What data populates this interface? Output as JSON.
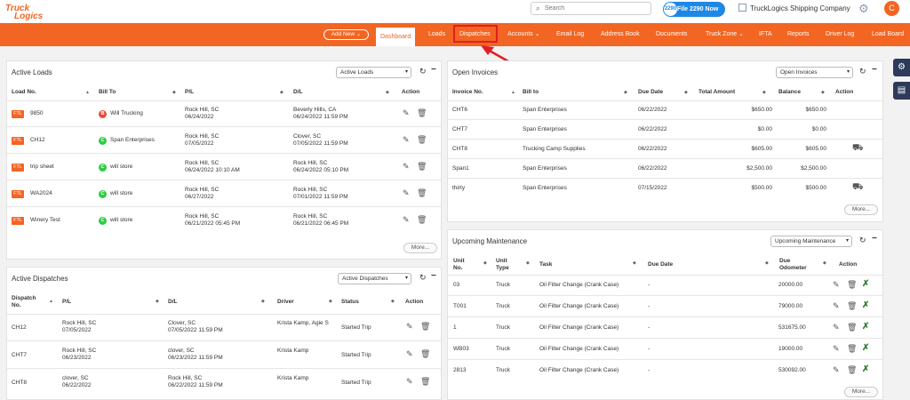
{
  "brand": {
    "logo_line1": "Truck",
    "logo_line2": "Logics"
  },
  "search": {
    "placeholder": "Search",
    "icon": "search-icon"
  },
  "header": {
    "file_btn": "File 2290 Now",
    "file_badge": "2290",
    "company": "TruckLogics Shipping Company",
    "avatar": "C"
  },
  "nav": {
    "add_new": "Add New ⌄",
    "items": [
      "Dashboard",
      "Loads",
      "Dispatches",
      "Accounts ⌄",
      "Email Log",
      "Address Book",
      "Documents",
      "Truck Zone ⌄",
      "IFTA",
      "Reports",
      "Driver Log",
      "Load Board"
    ],
    "active": "Dashboard",
    "highlighted": "Dispatches"
  },
  "colors": {
    "brand": "#f26522",
    "highlight": "#e31e24",
    "blue": "#1e88e5",
    "nav_dark": "#2e3a5a"
  },
  "active_loads": {
    "title": "Active Loads",
    "select": "Active Loads",
    "headers": [
      "Load No.",
      "Bill To",
      "P/L",
      "D/L",
      "Action"
    ],
    "rows": [
      {
        "type": "FTL",
        "no": "9850",
        "badge": "B",
        "badge_color": "#e74c3c",
        "bill": "Will Trucking",
        "pl1": "Rock Hill, SC",
        "pl2": "06/24/2022",
        "dl1": "Beverly Hills, CA",
        "dl2": "06/24/2022 11:59 PM"
      },
      {
        "type": "FTL",
        "no": "CH12",
        "badge": "C",
        "badge_color": "#2ecc40",
        "bill": "Span Enterprises",
        "pl1": "Rock Hill, SC",
        "pl2": "07/05/2022",
        "dl1": "Clover, SC",
        "dl2": "07/05/2022 11:59 PM"
      },
      {
        "type": "FTL",
        "no": "trip sheet",
        "badge": "C",
        "badge_color": "#2ecc40",
        "bill": "will store",
        "pl1": "Rock Hill, SC",
        "pl2": "06/24/2022 10:10 AM",
        "dl1": "Rock Hill, SC",
        "dl2": "06/24/2022 05:10 PM"
      },
      {
        "type": "FTL",
        "no": "WA2024",
        "badge": "C",
        "badge_color": "#2ecc40",
        "bill": "will store",
        "pl1": "Rock Hill, SC",
        "pl2": "06/27/2022",
        "dl1": "Rock Hill, SC",
        "dl2": "07/01/2022 11:59 PM"
      },
      {
        "type": "FTL",
        "no": "Winery Test",
        "badge": "C",
        "badge_color": "#2ecc40",
        "bill": "will store",
        "pl1": "Rock Hill, SC",
        "pl2": "06/21/2022 05:45 PM",
        "dl1": "Rock Hill, SC",
        "dl2": "06/21/2022 06:45 PM"
      }
    ],
    "more": "More..."
  },
  "active_dispatches": {
    "title": "Active Dispatches",
    "select": "Active Dispatches",
    "headers": [
      "Dispatch\nNo.",
      "P/L",
      "D/L",
      "Driver",
      "Status",
      "Action"
    ],
    "rows": [
      {
        "no": "CH12",
        "pl1": "Rock Hill, SC",
        "pl2": "07/05/2022",
        "dl1": "Clover, SC",
        "dl2": "07/05/2022 11:59 PM",
        "driver": "Krista Kamp, Agie S",
        "status": "Started Trip"
      },
      {
        "no": "CHT7",
        "pl1": "Rock Hill, SC",
        "pl2": "06/23/2022",
        "dl1": "clover, SC",
        "dl2": "06/23/2022 11:59 PM",
        "driver": "Krista Kamp",
        "status": "Started Trip"
      },
      {
        "no": "CHT8",
        "pl1": "clover, SC",
        "pl2": "06/22/2022",
        "dl1": "Rock Hill, SC",
        "dl2": "06/22/2022 11:59 PM",
        "driver": "Krista Kamp",
        "status": "Started Trip"
      }
    ]
  },
  "open_invoices": {
    "title": "Open Invoices",
    "select": "Open Invoices",
    "headers": [
      "Invoice No.",
      "Bill to",
      "Due Date",
      "Total Amount",
      "Balance",
      "Action"
    ],
    "rows": [
      {
        "no": "CHT6",
        "bill": "Span Enterprises",
        "due": "06/22/2022",
        "total": "$650.00",
        "balance": "$650.00",
        "dispatch_icon": false
      },
      {
        "no": "CHT7",
        "bill": "Span Enterprises",
        "due": "06/22/2022",
        "total": "$0.00",
        "balance": "$0.00",
        "dispatch_icon": false
      },
      {
        "no": "CHT8",
        "bill": "Trucking Camp Supplies",
        "due": "06/22/2022",
        "total": "$605.00",
        "balance": "$605.00",
        "dispatch_icon": true
      },
      {
        "no": "Span1",
        "bill": "Span Enterprises",
        "due": "06/22/2022",
        "total": "$2,500.00",
        "balance": "$2,500.00",
        "dispatch_icon": false
      },
      {
        "no": "thirty",
        "bill": "Span Enterprises",
        "due": "07/15/2022",
        "total": "$500.00",
        "balance": "$500.00",
        "dispatch_icon": true
      }
    ],
    "more": "More..."
  },
  "maintenance": {
    "title": "Upcoming Maintenance",
    "select": "Upcoming Maintenance",
    "headers": [
      "Unit\nNo.",
      "Unit\nType",
      "Task",
      "Due Date",
      "Due\nOdometer",
      "Action"
    ],
    "rows": [
      {
        "unit": "03",
        "type": "Truck",
        "task": "Oil Filter Change (Crank Case)",
        "due": "-",
        "odo": "20000.00"
      },
      {
        "unit": "T001",
        "type": "Truck",
        "task": "Oil Filter Change (Crank Case)",
        "due": "-",
        "odo": "79000.00"
      },
      {
        "unit": "1",
        "type": "Truck",
        "task": "Oil Filter Change (Crank Case)",
        "due": "-",
        "odo": "531675.00"
      },
      {
        "unit": "WB03",
        "type": "Truck",
        "task": "Oil Filter Change (Crank Case)",
        "due": "-",
        "odo": "19000.00"
      },
      {
        "unit": "2813",
        "type": "Truck",
        "task": "Oil Filter Change (Crank Case)",
        "due": "-",
        "odo": "530092.00"
      }
    ],
    "more": "More..."
  }
}
